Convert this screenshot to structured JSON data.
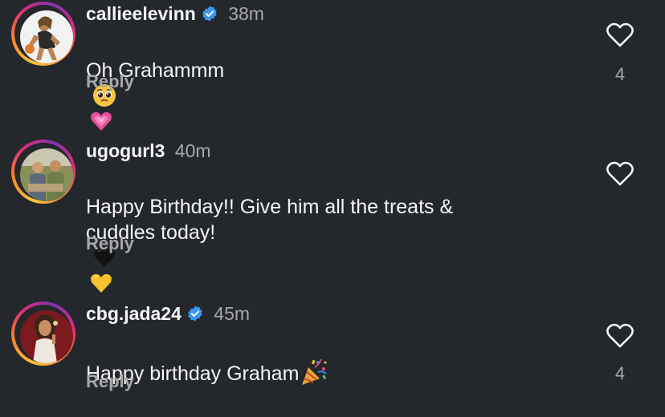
{
  "comments": [
    {
      "username": "callieelevinn",
      "verified": true,
      "time": "38m",
      "text": "Oh Grahammm",
      "emojis": [
        "pleading-face-emoji",
        "growing-heart-emoji"
      ],
      "reply_label": "Reply",
      "like_count": "4"
    },
    {
      "username": "ugogurl3",
      "verified": false,
      "time": "40m",
      "text": "Happy Birthday!! Give him all the treats &\ncuddles today!",
      "emojis": [
        "black-heart-emoji",
        "yellow-heart-emoji"
      ],
      "reply_label": "Reply",
      "like_count": ""
    },
    {
      "username": "cbg.jada24",
      "verified": true,
      "time": "45m",
      "text": "Happy birthday Graham",
      "emojis": [
        "party-popper-emoji"
      ],
      "reply_label": "Reply",
      "like_count": "4"
    }
  ],
  "colors": {
    "background": "#24272c",
    "text": "#f5f5f5",
    "secondary": "#a8a8a8",
    "verified_blue": "#3897f0"
  }
}
